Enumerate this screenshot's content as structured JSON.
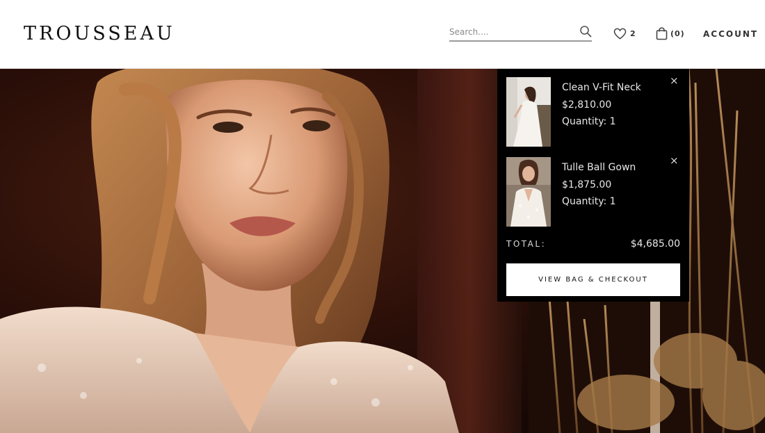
{
  "brand": {
    "logo": "TROUSSEAU"
  },
  "header": {
    "search": {
      "placeholder": "Search....",
      "icon": "search-icon"
    },
    "wishlist": {
      "icon": "heart-icon",
      "count": "2"
    },
    "bag": {
      "icon": "shopping-bag-icon",
      "count": "(0)"
    },
    "account_label": "ACCOUNT"
  },
  "minicart": {
    "items": [
      {
        "name": "Clean V-Fit Neck",
        "price": "$2,810.00",
        "quantity": "Quantity: 1",
        "remove": "×"
      },
      {
        "name": "Tulle Ball Gown",
        "price": "$1,875.00",
        "quantity": "Quantity: 1",
        "remove": "×"
      }
    ],
    "total_label": "TOTAL:",
    "total_value": "$4,685.00",
    "checkout_label": "VIEW BAG & CHECKOUT"
  },
  "colors": {
    "dropdown_bg": "#000000",
    "button_bg": "#ffffff",
    "text": "#222222"
  }
}
